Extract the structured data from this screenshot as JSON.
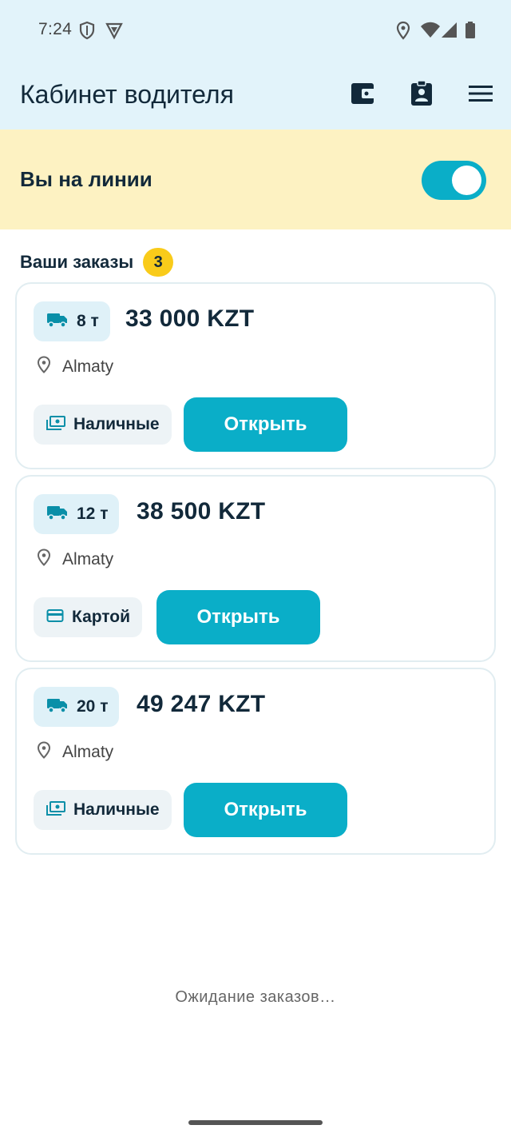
{
  "status_bar": {
    "time": "7:24"
  },
  "app_bar": {
    "title": "Кабинет водителя",
    "icons": [
      "wallet-icon",
      "id-card-icon",
      "menu-icon"
    ]
  },
  "online": {
    "label": "Вы на линии",
    "enabled": true
  },
  "orders": {
    "title": "Ваши заказы",
    "count": "3",
    "items": [
      {
        "tonnage": "8 т",
        "price": "33 000 KZT",
        "city": "Almaty",
        "payment": "Наличные",
        "payment_icon": "cash-icon",
        "open_label": "Открыть"
      },
      {
        "tonnage": "12 т",
        "price": "38 500 KZT",
        "city": "Almaty",
        "payment": "Картой",
        "payment_icon": "card-icon",
        "open_label": "Открыть"
      },
      {
        "tonnage": "20 т",
        "price": "49 247 KZT",
        "city": "Almaty",
        "payment": "Наличные",
        "payment_icon": "cash-icon",
        "open_label": "Открыть"
      }
    ]
  },
  "waiting_text": "Ожидание заказов…",
  "colors": {
    "accent": "#0aaec8",
    "header_bg": "#e2f3fa",
    "online_bg": "#fdf2c2",
    "badge": "#f9cb1a",
    "text": "#12293a"
  }
}
